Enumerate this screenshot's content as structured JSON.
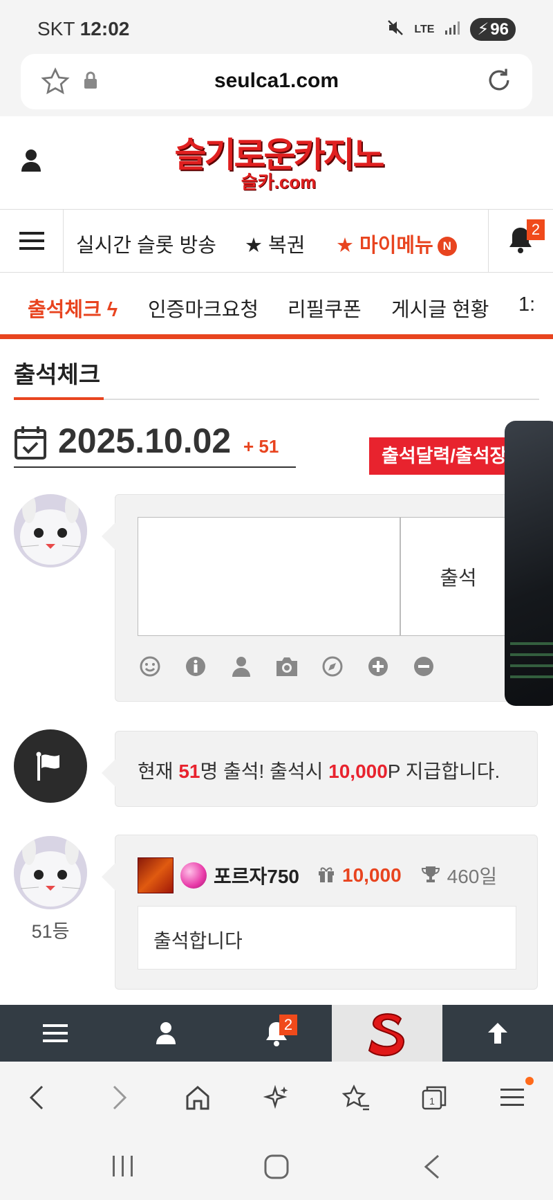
{
  "status": {
    "carrier": "SKT",
    "time": "12:02",
    "network": "LTE",
    "battery": "96"
  },
  "browser": {
    "url": "seulca1.com"
  },
  "site": {
    "logo_main": "슬기로운카지노",
    "logo_sub": "슬카.com",
    "nav": {
      "live": "실시간 슬롯 방송",
      "lotto": "★ 복권",
      "my_menu": "★ 마이메뉴",
      "my_menu_badge": "N",
      "bell_badge": "2"
    },
    "subnav": [
      "출석체크",
      "인증마크요청",
      "리필쿠폰",
      "게시글 현황",
      "1:"
    ]
  },
  "attendance": {
    "title": "출석체크",
    "date": "2025.10.02",
    "date_plus": "+ 51",
    "calendar_button": "출석달력/출석장",
    "submit_label": "출석",
    "notice": {
      "prefix": "현재 ",
      "count": "51",
      "mid": "명 출석! 출석시 ",
      "points": "10,000",
      "suffix": "P 지급합니다."
    },
    "entry": {
      "rank": "51등",
      "nickname": "포르자750",
      "points": "10,000",
      "days": "460일",
      "message": "출석합니다"
    }
  },
  "bottom_bar": {
    "bell_badge": "2"
  },
  "colors": {
    "accent": "#e8441f",
    "red": "#e8232e",
    "dark": "#333c44"
  }
}
